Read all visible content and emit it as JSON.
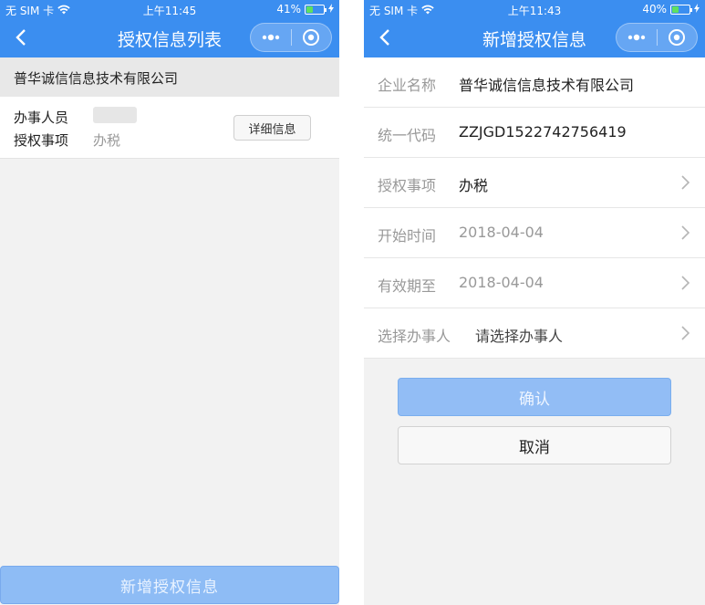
{
  "left": {
    "status": {
      "carrier": "无 SIM 卡",
      "time": "上午11:45",
      "battery": "41%",
      "battery_level": 0.41
    },
    "nav": {
      "title": "授权信息列表"
    },
    "company": "普华诚信信息技术有限公司",
    "record": {
      "agent_label": "办事人员",
      "matter_label": "授权事项",
      "matter_value": "办税",
      "detail_button": "详细信息"
    },
    "add_button": "新增授权信息"
  },
  "right": {
    "status": {
      "carrier": "无 SIM 卡",
      "time": "上午11:43",
      "battery": "40%",
      "battery_level": 0.4
    },
    "nav": {
      "title": "新增授权信息"
    },
    "form": {
      "company_label": "企业名称",
      "company_value": "普华诚信信息技术有限公司",
      "code_label": "统一代码",
      "code_value": "ZZJGD1522742756419",
      "matter_label": "授权事项",
      "matter_value": "办税",
      "start_label": "开始时间",
      "start_value": "2018-04-04",
      "expire_label": "有效期至",
      "expire_value": "2018-04-04",
      "agent_label": "选择办事人",
      "agent_placeholder": "请选择办事人"
    },
    "confirm_button": "确认",
    "cancel_button": "取消"
  },
  "colors": {
    "nav_blue": "#3b8ef0",
    "button_blue": "#8ebcf5"
  },
  "icons": [
    "back-icon",
    "more-icon",
    "home-circle-icon",
    "wifi-icon",
    "battery-icon",
    "chevron-right-icon"
  ]
}
